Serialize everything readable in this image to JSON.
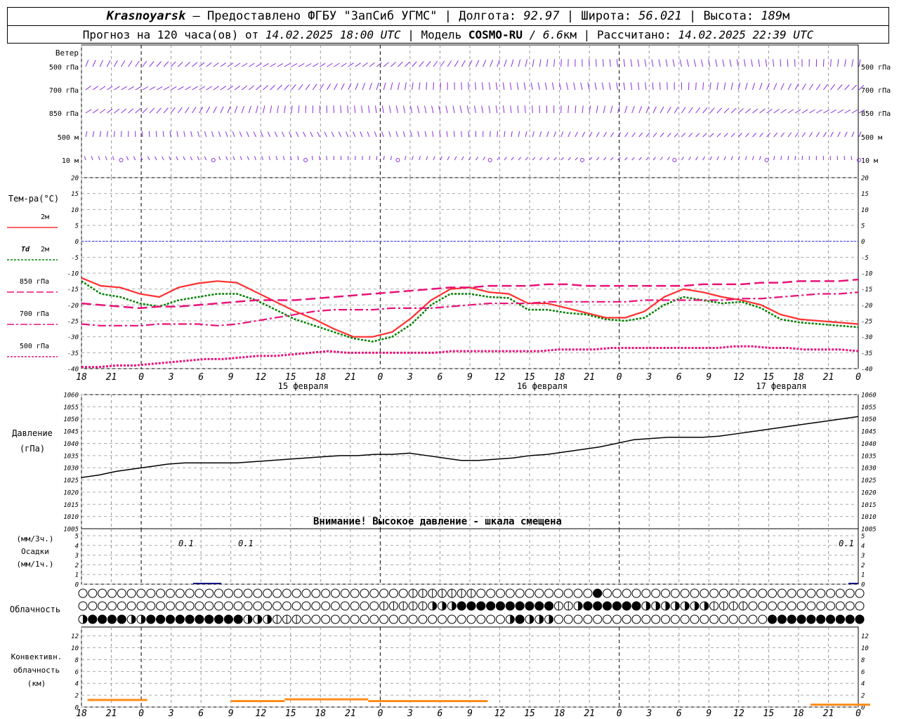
{
  "header": {
    "station": "Krasnoyarsk",
    "provider": "— Предоставлено ФГБУ \"ЗапСиб УГМС\"",
    "lon_label": "Долгота:",
    "lon": "92.97",
    "lat_label": "Широта:",
    "lat": "56.021",
    "alt_label": "Высота:",
    "alt": "189",
    "alt_unit": "м",
    "forecast_prefix": "Прогноз на 120 часа(ов) от",
    "forecast_time": "14.02.2025 18:00 UTC",
    "model_label": "| Модель",
    "model": "COSMO-RU",
    "resolution": "/ 6.6",
    "res_unit": "км",
    "calc_label": "| Рассчитано:",
    "calc_time": "14.02.2025 22:39 UTC",
    "sep": "|"
  },
  "colors": {
    "wind": "#8a2be2",
    "t2m": "#ff3030",
    "td": "#008000",
    "t850": "#e8127a",
    "t700": "#e8127a",
    "t500": "#e8127a",
    "zero_line": "#3030ff",
    "pressure": "#000000",
    "precip": "#000080",
    "conv": "#ff8c1a"
  },
  "chart_data": {
    "type": "meteogram",
    "time": {
      "hour_labels": [
        "18",
        "21",
        "0",
        "3",
        "6",
        "9",
        "12",
        "15",
        "18",
        "21",
        "0",
        "3",
        "6",
        "9",
        "12",
        "15",
        "18",
        "21",
        "0",
        "3",
        "6",
        "9",
        "12",
        "15",
        "18",
        "21",
        "0"
      ],
      "date_labels": [
        {
          "index": 7,
          "text": "15 февраля"
        },
        {
          "index": 15,
          "text": "16 февраля"
        },
        {
          "index": 23,
          "text": "17 февраля"
        }
      ],
      "midnight_indices": [
        2,
        10,
        18,
        26
      ]
    },
    "wind": {
      "title": "Ветер",
      "levels": [
        "500 гПа",
        "700 гПа",
        "850 гПа",
        "500 м",
        "10 м"
      ]
    },
    "temperature": {
      "title": "Тем-ра(°C)",
      "ylim": [
        -40,
        20
      ],
      "ticks": [
        20,
        15,
        10,
        5,
        0,
        -5,
        -10,
        -15,
        -20,
        -25,
        -30,
        -35,
        -40
      ],
      "legend": [
        {
          "label": "2м",
          "italic": ""
        },
        {
          "label": "2м",
          "italic": "Td"
        },
        {
          "label": "850 гПа",
          "italic": ""
        },
        {
          "label": "700 гПа",
          "italic": ""
        },
        {
          "label": "500 гПа",
          "italic": ""
        }
      ],
      "series": [
        {
          "key": "t2m",
          "values": [
            -11.5,
            -14,
            -14.5,
            -16.5,
            -17.5,
            -14.5,
            -13.2,
            -12.5,
            -13,
            -16,
            -19,
            -22,
            -24.5,
            -27.5,
            -30,
            -30,
            -28.5,
            -24,
            -18.5,
            -15,
            -14.5,
            -16,
            -16.5,
            -19.5,
            -19.5,
            -21,
            -22.5,
            -24,
            -24,
            -22,
            -17.5,
            -15,
            -16,
            -17.5,
            -18.5,
            -20,
            -23,
            -24.5,
            -25,
            -25.5,
            -26
          ]
        },
        {
          "key": "td",
          "values": [
            -12.5,
            -16.5,
            -17.5,
            -19.5,
            -20.5,
            -18.5,
            -17.5,
            -16.5,
            -16.5,
            -18.5,
            -21.5,
            -24.5,
            -26.5,
            -28.5,
            -30.5,
            -31.5,
            -30,
            -26,
            -20,
            -16.5,
            -16.5,
            -17.5,
            -17.8,
            -21.5,
            -21.5,
            -22.5,
            -23,
            -24.5,
            -25,
            -24,
            -20,
            -17.5,
            -18.5,
            -19.5,
            -19,
            -21,
            -24.5,
            -25.5,
            -26,
            -26.5,
            -27
          ]
        },
        {
          "key": "t850",
          "values": [
            -19.5,
            -20,
            -20.5,
            -21,
            -20.5,
            -20.5,
            -20,
            -19.5,
            -19,
            -18.5,
            -18.5,
            -18.5,
            -18,
            -17.5,
            -17,
            -16.5,
            -16,
            -15.5,
            -15,
            -14.5,
            -14.5,
            -14,
            -14,
            -14,
            -13.5,
            -13.5,
            -14,
            -14,
            -14,
            -14,
            -14,
            -14,
            -13.5,
            -13.5,
            -13.5,
            -13,
            -13,
            -12.5,
            -12.5,
            -12.5,
            -12
          ]
        },
        {
          "key": "t700",
          "values": [
            -26,
            -26.5,
            -26.5,
            -26.5,
            -26,
            -26,
            -26,
            -26.5,
            -26,
            -25,
            -24,
            -23,
            -22,
            -21.5,
            -21.5,
            -21.5,
            -21,
            -21,
            -21,
            -20.5,
            -20,
            -19.5,
            -19.5,
            -19.5,
            -19,
            -19,
            -19,
            -19,
            -19,
            -18.5,
            -18.5,
            -18.5,
            -18.5,
            -18.5,
            -18,
            -18,
            -17.5,
            -17,
            -16.5,
            -16.5,
            -16
          ]
        },
        {
          "key": "t500",
          "values": [
            -39.5,
            -39.5,
            -39,
            -39,
            -38.5,
            -38,
            -37.5,
            -37,
            -37,
            -36.5,
            -36,
            -36,
            -35.5,
            -35,
            -34.5,
            -35,
            -35,
            -35,
            -35,
            -35,
            -35,
            -34.5,
            -34.5,
            -34.5,
            -34.5,
            -34.5,
            -34.5,
            -34,
            -34,
            -34,
            -33.5,
            -33.5,
            -33.5,
            -33.5,
            -33.5,
            -33.5,
            -33.5,
            -33,
            -33,
            -33.5,
            -33.5,
            -34,
            -34,
            -34,
            -34.5
          ]
        }
      ]
    },
    "pressure": {
      "title": "Давление",
      "unit": "(гПа)",
      "ylim": [
        1005,
        1060
      ],
      "ticks": [
        1060,
        1055,
        1050,
        1045,
        1040,
        1035,
        1030,
        1025,
        1020,
        1015,
        1010,
        1005
      ],
      "values": [
        1026,
        1027,
        1028.5,
        1029.5,
        1030.5,
        1031.5,
        1032,
        1032,
        1032,
        1032,
        1032.5,
        1033,
        1033.5,
        1034,
        1034.5,
        1035,
        1035,
        1035.5,
        1035.5,
        1036,
        1035,
        1034,
        1033,
        1033,
        1033.5,
        1034,
        1035,
        1035.5,
        1036.5,
        1037.5,
        1038.5,
        1040,
        1041.5,
        1042,
        1042.5,
        1042.5,
        1042.5,
        1043,
        1044,
        1045,
        1046,
        1047,
        1048,
        1049,
        1050,
        1051
      ],
      "warning": "Внимание! Высокое давление - шкала смещена"
    },
    "precip": {
      "title": "Осадки",
      "unit_3h": "(мм/3ч.)",
      "unit_1h": "(мм/1ч.)",
      "ylim": [
        0,
        5
      ],
      "ticks": [
        5,
        4,
        3,
        2,
        1,
        0
      ],
      "labels": [
        {
          "x": 3.5,
          "text": "0.1"
        },
        {
          "x": 5.5,
          "text": "0.1"
        },
        {
          "x": 25.6,
          "text": "0.1"
        }
      ]
    },
    "clouds": {
      "title": "Облачность",
      "rows": [
        "0000000000000000000000000000000000000000111222222000000000000008000000000000000000000000000000000",
        "0000000000000000000000000000000000000000000011122244777888888888888882245888999988776655444332211000000000000000000",
        "6888486688888888888886664221000000000000000000000000000688666400000000000000000000000000008888888888888"
      ]
    },
    "convective": {
      "title": "Конвективн. облачность",
      "unit": "(км)",
      "ylim": [
        0,
        12
      ],
      "ticks": [
        12,
        10,
        8,
        6,
        4,
        2,
        0
      ],
      "segments": [
        {
          "x0": 0.1,
          "x1": 1.1,
          "h": 1.2
        },
        {
          "x0": 2.5,
          "x1": 3.4,
          "h": 1.0
        },
        {
          "x0": 3.4,
          "x1": 4.8,
          "h": 1.3
        },
        {
          "x0": 4.8,
          "x1": 6.8,
          "h": 1.0
        },
        {
          "x0": 12.2,
          "x1": 13.2,
          "h": 0.4
        },
        {
          "x0": 20.2,
          "x1": 20.6,
          "h": 0.4
        }
      ]
    }
  }
}
